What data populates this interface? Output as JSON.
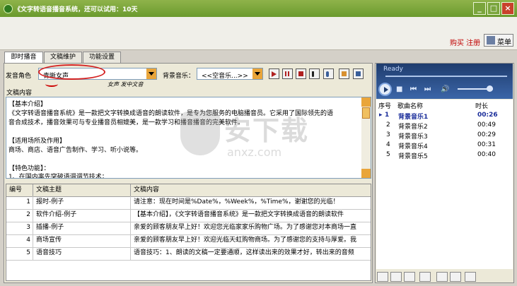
{
  "window": {
    "title": "《文字转语音播音系统，还可以试用：10天"
  },
  "header": {
    "buy_register": "购买 注册",
    "menu_label": "菜单"
  },
  "tabs": [
    {
      "label": "即时播音",
      "active": true
    },
    {
      "label": "文稿维护",
      "active": false
    },
    {
      "label": "功能设置",
      "active": false
    }
  ],
  "voice": {
    "label": "发音角色",
    "value": "青晰女声",
    "handwritten_note": "女声  发中文音"
  },
  "bgm": {
    "label": "背景音乐：",
    "value": "<<空音乐...>>"
  },
  "content": {
    "label": "文稿内容",
    "lines": [
      "【基本介绍】",
      "《文字转语音播音系统》是一款把文字转换成语音的朗读软件，是专为您服务的电脑播音员。它采用了国际领先的语",
      "音合成技术，播音效果可与专业播音员相媲美，是一款学习和播音播音的完美软件。",
      "",
      "【适用场所及作用】",
      "  商场、商店、语音广告制作、学习、听小说等。",
      "",
      "【特色功能】：",
      "  1、在国内率先突破语调调节技术；"
    ]
  },
  "watermark": {
    "title": "安下载",
    "sub": "anxz.com"
  },
  "table": {
    "headers": [
      "编号",
      "文稿主题",
      "文稿内容"
    ],
    "rows": [
      {
        "id": "1",
        "topic": "报时-例子",
        "text": "请注意：现在时间是%Date%，%Week%，%Time%，谢谢您的光临！"
      },
      {
        "id": "2",
        "topic": "软件介绍-例子",
        "text": "【基本介绍】，《文字转语音播音系统》是一款把文字转换成语音的朗读软件"
      },
      {
        "id": "3",
        "topic": "插播-例子",
        "text": "亲爱的顾客朋友早上好！欢迎您光临家家乐购物广场。为了感谢您对本商场一直"
      },
      {
        "id": "4",
        "topic": "商场宣传",
        "text": "亲爱的顾客朋友早上好！欢迎光临天虹购物商场。为了感谢您的支持与厚爱。我"
      },
      {
        "id": "5",
        "topic": "语音技巧",
        "text": "语音技巧：1、朗读的文稿一定要通顺，这样读出来的效果才好，转出来的音频"
      }
    ]
  },
  "player": {
    "status": "Ready"
  },
  "playlist": {
    "headers": [
      "序号",
      "歌曲名称",
      "时长"
    ],
    "rows": [
      {
        "no": "1",
        "name": "背景音乐1",
        "time": "00:26",
        "current": true
      },
      {
        "no": "2",
        "name": "背景音乐2",
        "time": "00:49",
        "current": false
      },
      {
        "no": "3",
        "name": "背景音乐3",
        "time": "00:29",
        "current": false
      },
      {
        "no": "4",
        "name": "背景音乐4",
        "time": "00:31",
        "current": false
      },
      {
        "no": "5",
        "name": "背景音乐5",
        "time": "00:40",
        "current": false
      }
    ]
  },
  "colors": {
    "title_bar": "#6a9a2e",
    "accent_red": "#d42020",
    "player_blue": "#1f3c6e",
    "playlist_text": "#1a2d9a"
  }
}
